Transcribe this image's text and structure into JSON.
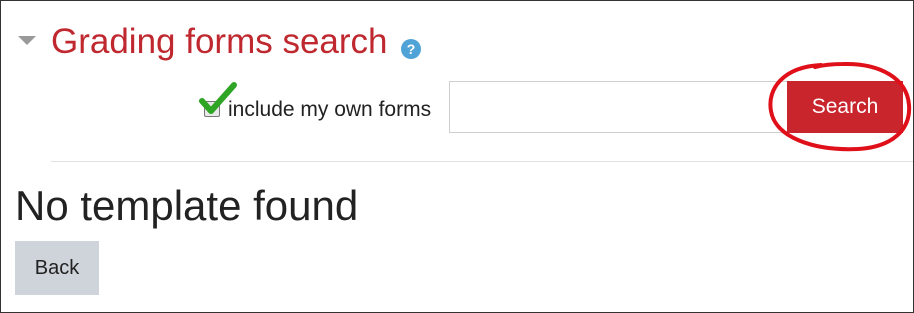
{
  "section": {
    "title": "Grading forms search",
    "collapse_icon": "triangle-down-icon",
    "help_icon": "question-mark-icon",
    "help_glyph": "?"
  },
  "filter": {
    "checkbox_label": "include my own forms",
    "checkbox_checked": true,
    "annotation_icon": "green-checkmark-icon"
  },
  "search": {
    "input_value": "",
    "input_placeholder": "",
    "button_label": "Search",
    "annotation": "red-circle-highlight"
  },
  "result": {
    "message": "No template found"
  },
  "actions": {
    "back_label": "Back"
  },
  "colors": {
    "title": "#c0282f",
    "primary_button": "#c9252c",
    "secondary_button": "#ced4da",
    "help_icon": "#4fa3d6",
    "annotation_circle": "#e0101a",
    "annotation_check": "#2fa526"
  }
}
